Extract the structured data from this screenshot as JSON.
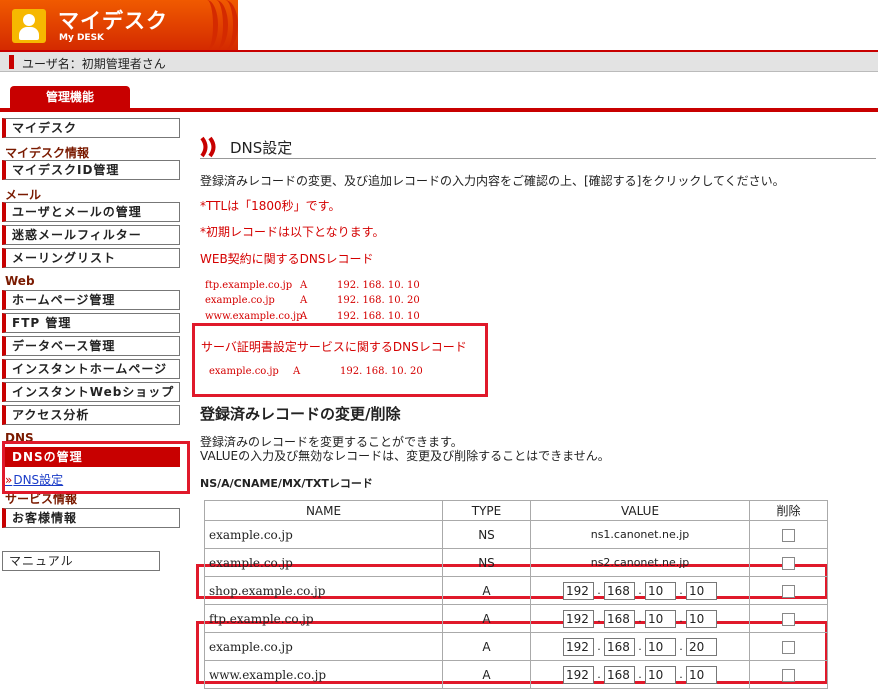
{
  "header": {
    "app_title": "マイデスク",
    "app_subtitle": "My DESK",
    "user_label": "ユーザ名：初期管理者さん"
  },
  "tab": {
    "label": "管理機能"
  },
  "sidebar": {
    "mydesk": "マイデスク",
    "section_mydesk_info": "マイデスク情報",
    "mydesk_id": "マイデスクID管理",
    "section_mail": "メール",
    "user_mail": "ユーザとメールの管理",
    "spam_filter": "迷惑メールフィルター",
    "mailing_list": "メーリングリスト",
    "section_web": "Web",
    "homepage": "ホームページ管理",
    "ftp": "FTP 管理",
    "database": "データベース管理",
    "instant_homepage": "インスタントホームページ",
    "instant_shop": "インスタントWebショップ",
    "access": "アクセス分析",
    "section_dns": "DNS",
    "dns_manage": "DNSの管理",
    "dns_settings": "DNS設定",
    "section_service": "サービス情報",
    "customer_info": "お客様情報",
    "manual": "マニュアル"
  },
  "main": {
    "title": "DNS設定",
    "intro": "登録済みレコードの変更、及び追加レコードの入力内容をご確認の上、[確認する]をクリックしてください。",
    "ttl_note": "*TTLは「1800秒」です。",
    "initial_note": "*初期レコードは以下となります。",
    "web_records_title": "WEB契約に関するDNSレコード",
    "web_records": [
      {
        "name": "ftp.example.co.jp",
        "type": "A",
        "value": "192. 168. 10. 10"
      },
      {
        "name": "example.co.jp",
        "type": "A",
        "value": "192. 168. 10. 20"
      },
      {
        "name": "www.example.co.jp",
        "type": "A",
        "value": "192. 168. 10. 10"
      }
    ],
    "cert_records_title": "サーバ証明書設定サービスに関するDNSレコード",
    "cert_records": [
      {
        "name": "example.co.jp",
        "type": "A",
        "value": "192. 168. 10. 20"
      }
    ],
    "section_title": "登録済みレコードの変更/削除",
    "section_desc_1": "登録済みのレコードを変更することができます。",
    "section_desc_2": "VALUEの入力及び無効なレコードは、変更及び削除することはできません。",
    "record_types": "NS/A/CNAME/MX/TXTレコード",
    "table": {
      "headers": {
        "name": "NAME",
        "type": "TYPE",
        "value": "VALUE",
        "delete": "削除"
      },
      "rows": [
        {
          "name": "example.co.jp",
          "type": "NS",
          "value": "ns1.canonet.ne.jp"
        },
        {
          "name": "example.co.jp",
          "type": "NS",
          "value": "ns2.canonet.ne.jp"
        },
        {
          "name": "shop.example.co.jp",
          "type": "A",
          "ip": [
            "192",
            "168",
            "10",
            "10"
          ]
        },
        {
          "name": "ftp.example.co.jp",
          "type": "A",
          "ip": [
            "192",
            "168",
            "10",
            "10"
          ]
        },
        {
          "name": "example.co.jp",
          "type": "A",
          "ip": [
            "192",
            "168",
            "10",
            "20"
          ]
        },
        {
          "name": "www.example.co.jp",
          "type": "A",
          "ip": [
            "192",
            "168",
            "10",
            "10"
          ]
        }
      ]
    }
  },
  "colors": {
    "brand": "#c80000",
    "highlight_box": "#e0192a",
    "note_text": "#d40000"
  }
}
